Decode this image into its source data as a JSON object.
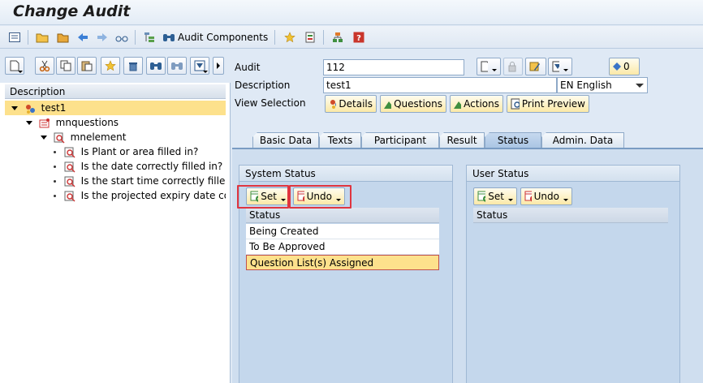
{
  "window": {
    "title": "Change Audit"
  },
  "app_toolbar": {
    "audit_components_label": "Audit Components"
  },
  "tree": {
    "header": "Description",
    "nodes": [
      {
        "label": "test1",
        "level": 0,
        "selected": true
      },
      {
        "label": "mnquestions",
        "level": 1
      },
      {
        "label": "mnelement",
        "level": 2
      },
      {
        "label": "Is Plant or area filled in?",
        "level": 3
      },
      {
        "label": "Is the date correctly filled in?",
        "level": 3
      },
      {
        "label": "Is the start time correctly filled",
        "level": 3
      },
      {
        "label": "Is the projected expiry date cor",
        "level": 3
      }
    ]
  },
  "form": {
    "audit_label": "Audit",
    "audit_value": "112",
    "description_label": "Description",
    "description_value": "test1",
    "language_value": "EN English",
    "view_selection_label": "View Selection",
    "counter_value": "0"
  },
  "view_buttons": {
    "details": "Details",
    "questions": "Questions",
    "actions": "Actions",
    "print_preview": "Print Preview"
  },
  "tabs": [
    {
      "label": "Basic Data"
    },
    {
      "label": "Texts"
    },
    {
      "label": "Participant"
    },
    {
      "label": "Result"
    },
    {
      "label": "Status",
      "active": true
    },
    {
      "label": "Admin. Data"
    }
  ],
  "system_status": {
    "title": "System Status",
    "set_label": "Set",
    "undo_label": "Undo",
    "column_header": "Status",
    "rows": [
      "Being Created",
      "To Be Approved",
      "Question List(s) Assigned"
    ],
    "selected_row": 2
  },
  "user_status": {
    "title": "User Status",
    "set_label": "Set",
    "undo_label": "Undo",
    "column_header": "Status"
  },
  "colors": {
    "highlight": "#fde18c",
    "annotation_red": "#e0353f",
    "background": "#dfe9f5"
  }
}
